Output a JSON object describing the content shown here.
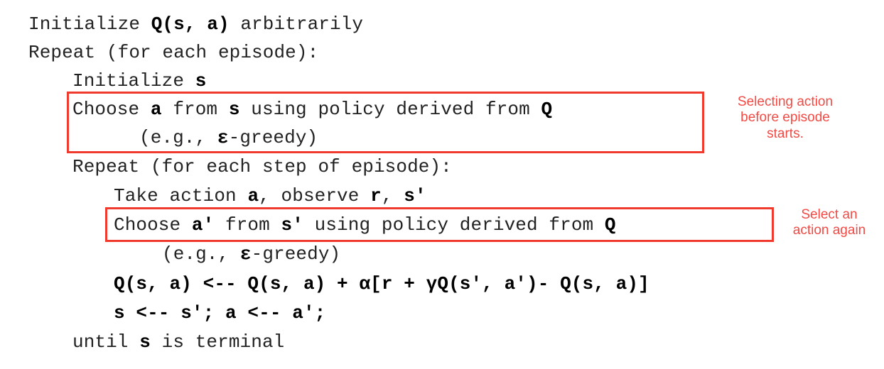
{
  "algorithm": {
    "lines": [
      {
        "id": "init-q",
        "parts": [
          {
            "t": "Initialize ",
            "b": false
          },
          {
            "t": "Q(s, a)",
            "b": true
          },
          {
            "t": " arbitrarily",
            "b": false
          }
        ]
      },
      {
        "id": "repeat-episode",
        "parts": [
          {
            "t": "Repeat (for each episode):",
            "b": false
          }
        ]
      },
      {
        "id": "init-s",
        "parts": [
          {
            "t": "Initialize ",
            "b": false
          },
          {
            "t": "s",
            "b": true
          }
        ]
      },
      {
        "id": "choose-a",
        "parts": [
          {
            "t": "Choose ",
            "b": false
          },
          {
            "t": "a",
            "b": true
          },
          {
            "t": " from ",
            "b": false
          },
          {
            "t": "s",
            "b": true
          },
          {
            "t": " using policy derived from ",
            "b": false
          },
          {
            "t": "Q",
            "b": true
          }
        ]
      },
      {
        "id": "egreedy-1",
        "parts": [
          {
            "t": "(e.g., ",
            "b": false
          },
          {
            "t": "ε",
            "b": true
          },
          {
            "t": "-greedy)",
            "b": false
          }
        ]
      },
      {
        "id": "repeat-step",
        "parts": [
          {
            "t": "Repeat (for each step of episode):",
            "b": false
          }
        ]
      },
      {
        "id": "take-action",
        "parts": [
          {
            "t": "Take action ",
            "b": false
          },
          {
            "t": "a",
            "b": true
          },
          {
            "t": ", observe ",
            "b": false
          },
          {
            "t": "r",
            "b": true
          },
          {
            "t": ", ",
            "b": false
          },
          {
            "t": "s'",
            "b": true
          }
        ]
      },
      {
        "id": "choose-a-prime",
        "parts": [
          {
            "t": "Choose ",
            "b": false
          },
          {
            "t": "a'",
            "b": true
          },
          {
            "t": " from ",
            "b": false
          },
          {
            "t": "s'",
            "b": true
          },
          {
            "t": " using policy derived from ",
            "b": false
          },
          {
            "t": "Q",
            "b": true
          }
        ]
      },
      {
        "id": "egreedy-2",
        "parts": [
          {
            "t": "(e.g., ",
            "b": false
          },
          {
            "t": "ε",
            "b": true
          },
          {
            "t": "-greedy)",
            "b": false
          }
        ]
      },
      {
        "id": "update-rule",
        "parts": [
          {
            "t": "Q(s, a) <-- Q(s, a) + α[r + γQ(s', a')- Q(s, a)]",
            "b": true
          }
        ]
      },
      {
        "id": "assign",
        "parts": [
          {
            "t": "s <-- s'; a <-- a';",
            "b": true
          }
        ]
      },
      {
        "id": "until",
        "parts": [
          {
            "t": "until ",
            "b": false
          },
          {
            "t": "s",
            "b": true
          },
          {
            "t": " is terminal",
            "b": false
          }
        ]
      }
    ]
  },
  "annotations": {
    "first": {
      "lines": [
        "Selecting action",
        "before episode",
        "starts."
      ]
    },
    "second": {
      "lines": [
        "Select an",
        "action again"
      ]
    }
  },
  "colors": {
    "highlight": "#f03a2e",
    "annotation_text": "#f24a44"
  }
}
